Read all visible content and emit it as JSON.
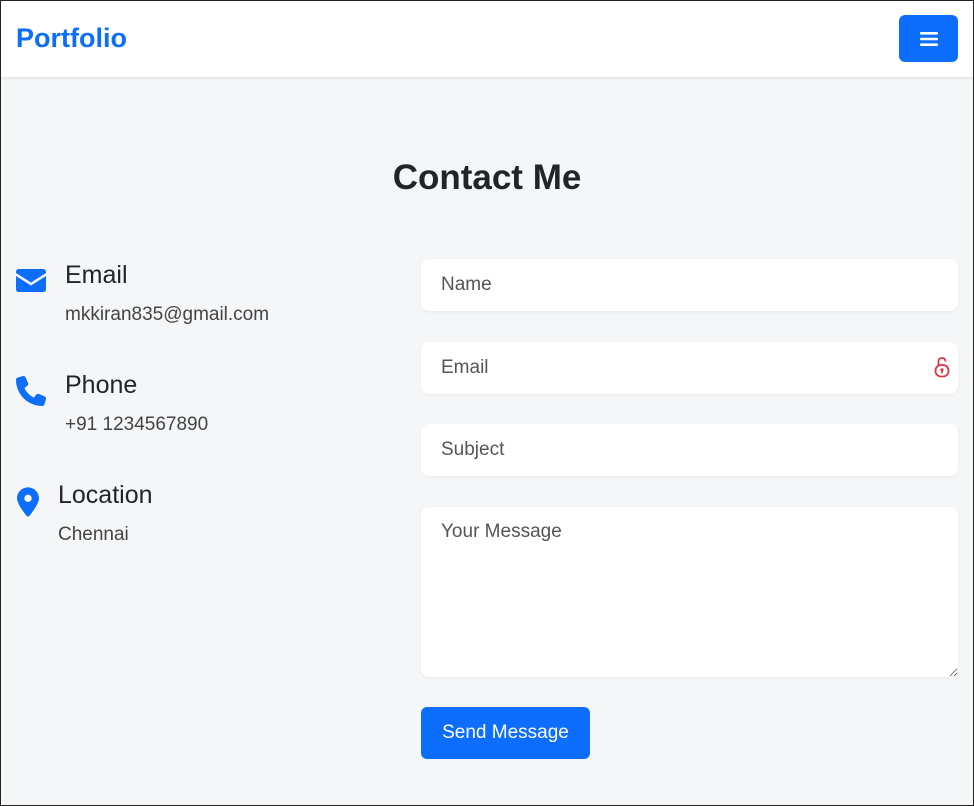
{
  "navbar": {
    "brand": "Portfolio",
    "menu_icon": "hamburger-menu-icon",
    "brand_color": "#0d6efd"
  },
  "contact": {
    "heading": "Contact Me",
    "items": [
      {
        "icon": "envelope-icon",
        "label": "Email",
        "value": "mkkiran835@gmail.com"
      },
      {
        "icon": "phone-icon",
        "label": "Phone",
        "value": "+91 1234567890"
      },
      {
        "icon": "map-pin-icon",
        "label": "Location",
        "value": "Chennai"
      }
    ]
  },
  "form": {
    "name_placeholder": "Name",
    "email_placeholder": "Email",
    "email_field_icon": "password-manager-lock-icon",
    "subject_placeholder": "Subject",
    "message_placeholder": "Your Message",
    "submit_label": "Send Message"
  },
  "colors": {
    "accent": "#0d6efd",
    "background": "#f5f6f8",
    "lock_icon": "#dc3545"
  }
}
